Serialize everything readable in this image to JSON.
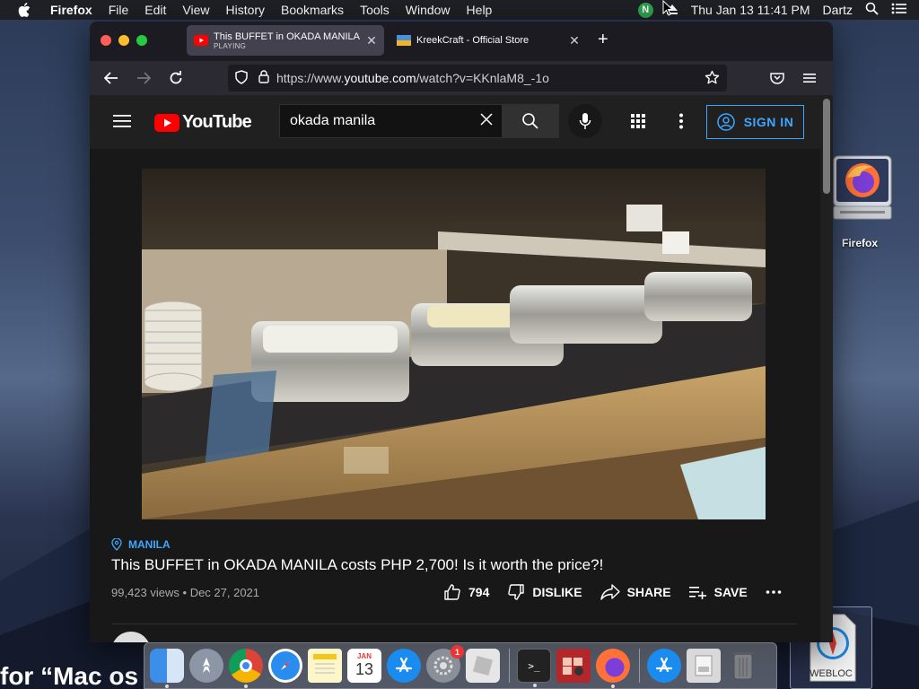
{
  "menubar": {
    "app_name": "Firefox",
    "items": [
      "File",
      "Edit",
      "View",
      "History",
      "Bookmarks",
      "Tools",
      "Window",
      "Help"
    ],
    "status_badge": "N",
    "datetime": "Thu Jan 13  11:41 PM",
    "user": "Dartz"
  },
  "browser": {
    "tabs": [
      {
        "title": "This BUFFET in OKADA MANILA",
        "subtitle": "PLAYING",
        "active": true
      },
      {
        "title": "KreekCraft - Official Store",
        "active": false
      }
    ],
    "url_prefix": "https://www.",
    "url_domain": "youtube.com",
    "url_suffix": "/watch?v=KKnlaM8_-1o"
  },
  "youtube": {
    "logo_text": "YouTube",
    "search_value": "okada manila",
    "sign_in_label": "SIGN IN",
    "video": {
      "location": "MANILA",
      "title": "This BUFFET in OKADA MANILA costs PHP 2,700! Is it worth the price?!",
      "views": "99,423 views",
      "date": "Dec 27, 2021",
      "likes": "794",
      "dislike_label": "DISLIKE",
      "share_label": "SHARE",
      "save_label": "SAVE"
    }
  },
  "desktop": {
    "firefox_label": "Firefox",
    "webloc_label": "WEBLOC",
    "background_text": "for “Mac os"
  },
  "dock": {
    "calendar_month": "JAN",
    "calendar_day": "13",
    "prefs_badge": "1"
  },
  "colors": {
    "accent_blue": "#3ea6ff",
    "youtube_red": "#ff0000",
    "yt_bg": "#181818",
    "firefox_bg": "#1c1b22"
  }
}
